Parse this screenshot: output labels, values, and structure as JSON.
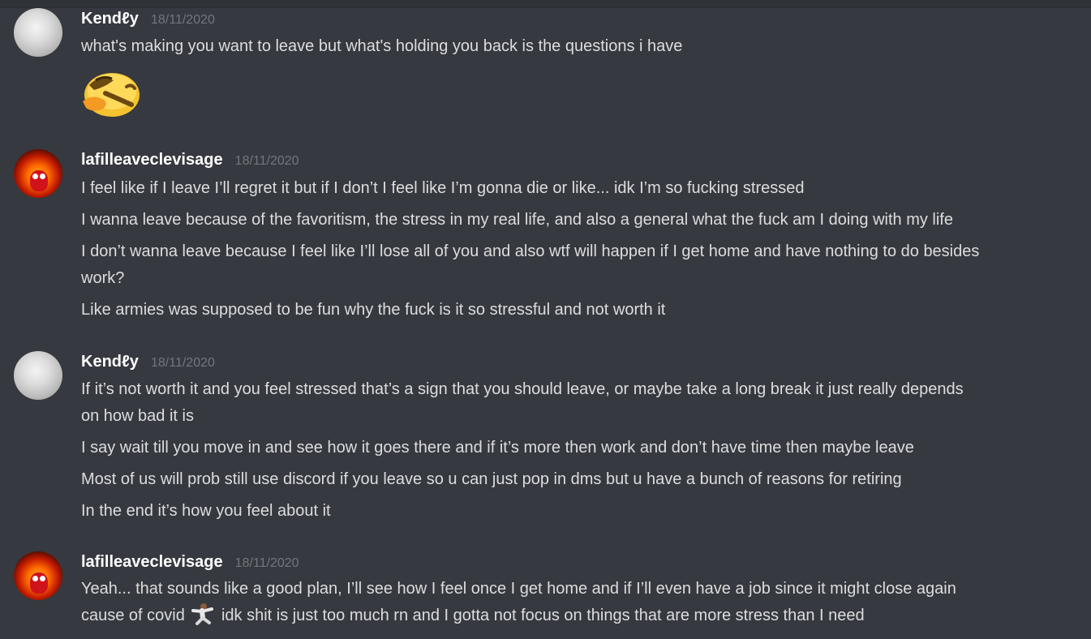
{
  "messages": [
    {
      "author": "Kendℓy",
      "avatar": "moon-avatar",
      "timestamp": "18/11/2020",
      "lines": [
        "what's making you want to leave but what's holding you back is the questions i have"
      ],
      "attachment_emoji": "thinking-face-custom-emoji"
    },
    {
      "author": "lafilleaveclevisage",
      "avatar": "fire-elmo-avatar",
      "timestamp": "18/11/2020",
      "lines": [
        "I feel like if I leave I’ll regret it but if I don’t I feel like I’m gonna die or like... idk I’m so fucking stressed",
        "I wanna leave because of the favoritism, the stress in my real life, and also a general what the fuck am I doing with my life",
        "I don’t wanna leave because I feel like I’ll lose all of you and also wtf will happen if I get home and have nothing to do besides",
        "work?",
        "Like armies was supposed to be fun why the fuck is it so stressful and not worth it"
      ]
    },
    {
      "author": "Kendℓy",
      "avatar": "moon-avatar",
      "timestamp": "18/11/2020",
      "lines": [
        "If it’s not worth it and you feel stressed that’s a sign that you should leave, or maybe take a long break it just really depends",
        "on how bad it is",
        "I say wait till you move in and see how it goes there and if it’s more then work and don’t have time then maybe leave",
        "Most of us will prob still use discord if you leave so u can just pop in dms but u have a bunch of reasons for retiring",
        "In the end it’s how you feel about it"
      ]
    },
    {
      "author": "lafilleaveclevisage",
      "avatar": "fire-elmo-avatar",
      "timestamp": "18/11/2020",
      "lines": [
        "Yeah... that sounds like a good plan, I’ll see how I feel once I get home and if I’ll even have a job since it might close again",
        "cause of covid",
        "idk shit is just too much rn and I gotta not focus on things that are more stress than I need"
      ],
      "inline_emoji": "dancing-man-emoji"
    }
  ],
  "colors": {
    "background": "#36393f",
    "username": "#ffffff",
    "timestamp": "#72767d",
    "message_text": "#dcddde"
  }
}
